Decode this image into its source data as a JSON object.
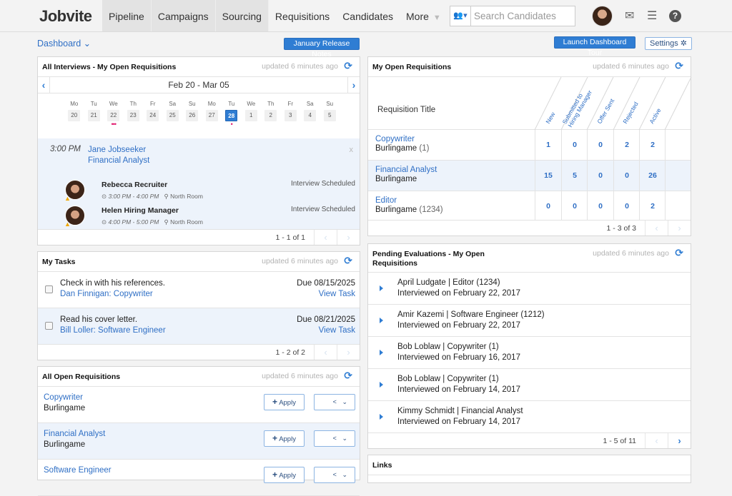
{
  "app": {
    "logo": "Jobvite",
    "nav": [
      {
        "label": "Pipeline"
      },
      {
        "label": "Campaigns"
      },
      {
        "label": "Sourcing"
      },
      {
        "label": "Requisitions"
      },
      {
        "label": "Candidates"
      },
      {
        "label": "More"
      }
    ],
    "search_placeholder": "Search Candidates"
  },
  "subheader": {
    "dashboard_label": "Dashboard",
    "release_notes_label": "January Release Notes",
    "tour_label": "Launch Dashboard Tour",
    "settings_label": "Settings"
  },
  "interviews": {
    "title": "All Interviews - My Open Requisitions",
    "updated": "updated 6 minutes ago",
    "range": "Feb 20 - Mar 05",
    "days": [
      {
        "dow": "Mo",
        "num": "20",
        "dots": 0
      },
      {
        "dow": "Tu",
        "num": "21",
        "dots": 0
      },
      {
        "dow": "We",
        "num": "22",
        "dots": 3
      },
      {
        "dow": "Th",
        "num": "23",
        "dots": 0
      },
      {
        "dow": "Fr",
        "num": "24",
        "dots": 0
      },
      {
        "dow": "Sa",
        "num": "25",
        "dots": 0
      },
      {
        "dow": "Su",
        "num": "26",
        "dots": 0
      },
      {
        "dow": "Mo",
        "num": "27",
        "dots": 0
      },
      {
        "dow": "Tu",
        "num": "28",
        "dots": 1,
        "selected": true
      },
      {
        "dow": "We",
        "num": "1",
        "dots": 0
      },
      {
        "dow": "Th",
        "num": "2",
        "dots": 0
      },
      {
        "dow": "Fr",
        "num": "3",
        "dots": 0
      },
      {
        "dow": "Sa",
        "num": "4",
        "dots": 0
      },
      {
        "dow": "Su",
        "num": "5",
        "dots": 0
      }
    ],
    "event": {
      "time": "3:00 PM",
      "candidate": "Jane Jobseeker",
      "position": "Financial Analyst",
      "close": "x",
      "interviewers": [
        {
          "name": "Rebecca Recruiter",
          "time": "3:00 PM - 4:00 PM",
          "location": "North Room",
          "status": "Interview Scheduled"
        },
        {
          "name": "Helen Hiring Manager",
          "time": "4:00 PM - 5:00 PM",
          "location": "North Room",
          "status": "Interview Scheduled"
        }
      ]
    },
    "pager": "1 - 1 of 1"
  },
  "my_reqs": {
    "title": "My Open Requisitions",
    "updated": "updated 6 minutes ago",
    "title_col": "Requisition Title",
    "columns": [
      "New",
      "Submitted to Hiring Manager",
      "Offer Sent",
      "Rejected",
      "Active"
    ],
    "rows": [
      {
        "title": "Copywriter",
        "location": "Burlingame",
        "id": "(1)",
        "values": [
          "1",
          "0",
          "0",
          "2",
          "2"
        ]
      },
      {
        "title": "Financial Analyst",
        "location": "Burlingame",
        "id": "",
        "values": [
          "15",
          "5",
          "0",
          "0",
          "26"
        ]
      },
      {
        "title": "Editor",
        "location": "Burlingame",
        "id": "(1234)",
        "values": [
          "0",
          "0",
          "0",
          "0",
          "2"
        ]
      }
    ],
    "pager": "1 - 3 of 3"
  },
  "tasks": {
    "title": "My Tasks",
    "updated": "updated 6 minutes ago",
    "items": [
      {
        "task": "Check in with his references.",
        "link": "Dan Finnigan: Copywriter",
        "due": "Due 08/15/2025",
        "view": "View Task"
      },
      {
        "task": "Read his cover letter.",
        "link": "Bill Loller: Software Engineer",
        "due": "Due 08/21/2025",
        "view": "View Task"
      }
    ],
    "pager": "1 - 2 of 2"
  },
  "all_reqs": {
    "title": "All Open Requisitions",
    "updated": "updated 6 minutes ago",
    "apply_label": "Apply",
    "items": [
      {
        "title": "Copywriter",
        "location": "Burlingame"
      },
      {
        "title": "Financial Analyst",
        "location": "Burlingame"
      },
      {
        "title": "Software Engineer",
        "location": ""
      }
    ]
  },
  "evals": {
    "title_line1": "Pending Evaluations - My Open",
    "title_line2": "Requisitions",
    "updated": "updated 6 minutes ago",
    "items": [
      {
        "line1": "April Ludgate | Editor (1234)",
        "line2": "Interviewed on February 22, 2017"
      },
      {
        "line1": "Amir Kazemi | Software Engineer (1212)",
        "line2": "Interviewed on February 22, 2017"
      },
      {
        "line1": "Bob Loblaw | Copywriter (1)",
        "line2": "Interviewed on February 16, 2017"
      },
      {
        "line1": "Bob Loblaw | Copywriter (1)",
        "line2": "Interviewed on February 14, 2017"
      },
      {
        "line1": "Kimmy Schmidt | Financial Analyst",
        "line2": "Interviewed on February 14, 2017"
      }
    ],
    "pager": "1 - 5 of 11"
  },
  "links": {
    "title": "Links"
  }
}
